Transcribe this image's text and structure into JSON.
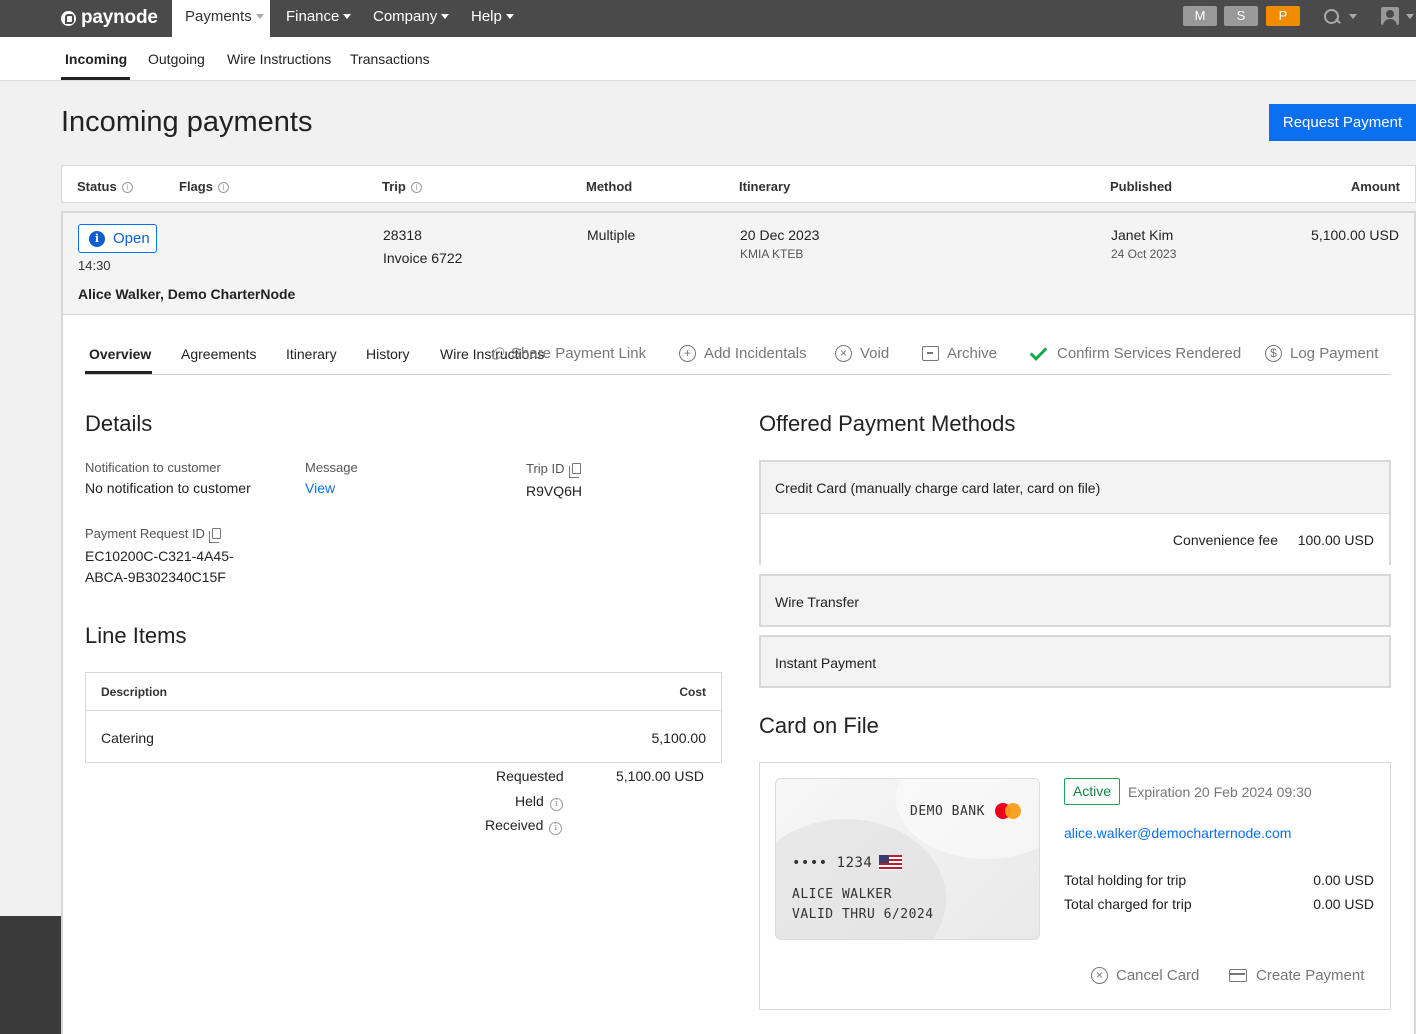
{
  "app": {
    "logo": "paynode"
  },
  "topnav": [
    {
      "label": "Payments"
    },
    {
      "label": "Finance"
    },
    {
      "label": "Company"
    },
    {
      "label": "Help"
    }
  ],
  "badges": [
    {
      "label": "M",
      "color": "#999999"
    },
    {
      "label": "S",
      "color": "#999999"
    },
    {
      "label": "P",
      "color": "#f08c00"
    }
  ],
  "subnav": [
    {
      "label": "Incoming"
    },
    {
      "label": "Outgoing"
    },
    {
      "label": "Wire Instructions"
    },
    {
      "label": "Transactions"
    }
  ],
  "page": {
    "title": "Incoming payments",
    "request_button": "Request Payment"
  },
  "table": {
    "headers": {
      "status": "Status",
      "flags": "Flags",
      "trip": "Trip",
      "method": "Method",
      "itinerary": "Itinerary",
      "published": "Published",
      "amount": "Amount"
    }
  },
  "row": {
    "status": "Open",
    "time": "14:30",
    "customer": "Alice Walker, Demo CharterNode",
    "trip_number": "28318",
    "invoice": "Invoice 6722",
    "method": "Multiple",
    "itinerary_date": "20 Dec 2023",
    "itinerary_route": "KMIA KTEB",
    "published_by": "Janet Kim",
    "published_date": "24 Oct 2023",
    "amount": "5,100.00 USD"
  },
  "detail_tabs": [
    {
      "label": "Overview"
    },
    {
      "label": "Agreements"
    },
    {
      "label": "Itinerary"
    },
    {
      "label": "History"
    },
    {
      "label": "Wire Instructions"
    }
  ],
  "actions": {
    "share": "Share Payment Link",
    "add_incidentals": "Add Incidentals",
    "void": "Void",
    "archive": "Archive",
    "confirm": "Confirm Services Rendered",
    "log_payment": "Log Payment"
  },
  "details": {
    "title": "Details",
    "notification_label": "Notification to customer",
    "notification_value": "No notification to customer",
    "message_label": "Message",
    "message_link": "View",
    "trip_id_label": "Trip ID",
    "trip_id_value": "R9VQ6H",
    "payment_request_label": "Payment Request ID",
    "payment_request_line1": "EC10200C-C321-4A45-",
    "payment_request_line2": "ABCA-9B302340C15F"
  },
  "line_items": {
    "title": "Line Items",
    "col_description": "Description",
    "col_cost": "Cost",
    "rows": [
      {
        "description": "Catering",
        "cost": "5,100.00"
      }
    ],
    "requested_label": "Requested",
    "requested_value": "5,100.00 USD",
    "held_label": "Held",
    "received_label": "Received"
  },
  "payment_methods": {
    "title": "Offered Payment Methods",
    "credit_card": "Credit Card (manually charge card later, card on file)",
    "convenience_fee_label": "Convenience fee",
    "convenience_fee_value": "100.00 USD",
    "wire": "Wire Transfer",
    "instant": "Instant Payment"
  },
  "card_on_file": {
    "title": "Card on File",
    "bank": "DEMO BANK",
    "number": "•••• 1234",
    "holder": "ALICE WALKER",
    "valid_thru": "VALID THRU 6/2024",
    "status": "Active",
    "expiration": "Expiration 20 Feb 2024 09:30",
    "email": "alice.walker@democharternode.com",
    "holding_label": "Total holding for trip",
    "holding_value": "0.00 USD",
    "charged_label": "Total charged for trip",
    "charged_value": "0.00 USD",
    "cancel_card": "Cancel Card",
    "create_payment": "Create Payment"
  }
}
